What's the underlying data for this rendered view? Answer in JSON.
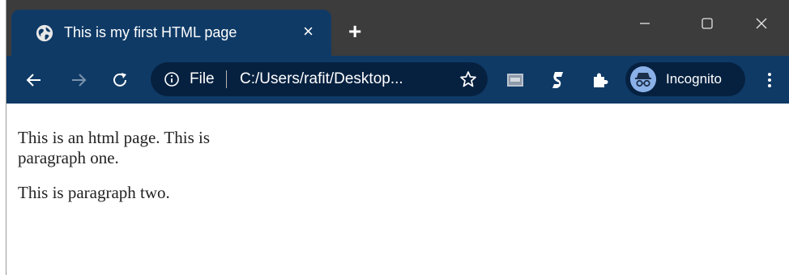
{
  "tab": {
    "title": "This is my first HTML page",
    "close_label": "×"
  },
  "new_tab_label": "+",
  "address_bar": {
    "scheme_label": "File",
    "url": "C:/Users/rafit/Desktop..."
  },
  "profile": {
    "label": "Incognito"
  },
  "page": {
    "paragraphs": [
      "This is an html page. This is paragraph one.",
      "This is paragraph two."
    ]
  },
  "colors": {
    "titlebar": "#3c3c3c",
    "toolbar": "#0f3a66",
    "omnibox": "#062140"
  },
  "icons": [
    "globe-icon",
    "close-icon",
    "plus-icon",
    "minimize-icon",
    "maximize-icon",
    "window-close-icon",
    "back-arrow-icon",
    "forward-arrow-icon",
    "reload-icon",
    "info-icon",
    "bookmark-star-icon",
    "extension-image-icon",
    "extension-s-icon",
    "puzzle-icon",
    "incognito-icon",
    "kebab-menu-icon"
  ]
}
